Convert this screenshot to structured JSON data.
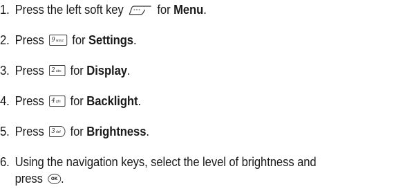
{
  "steps": [
    {
      "num": "1.",
      "pre": "Press the left soft key",
      "post": "for",
      "bold": "Menu",
      "tail": "."
    },
    {
      "num": "2.",
      "pre": "Press",
      "key": {
        "digit": "9",
        "letters": "wxyz"
      },
      "post": "for",
      "bold": "Settings",
      "tail": "."
    },
    {
      "num": "3.",
      "pre": "Press",
      "key": {
        "digit": "2",
        "letters": "abc"
      },
      "post": "for",
      "bold": "Display",
      "tail": "."
    },
    {
      "num": "4.",
      "pre": "Press",
      "key": {
        "digit": "4",
        "letters": "ghi"
      },
      "post": "for",
      "bold": "Backlight",
      "tail": "."
    },
    {
      "num": "5.",
      "pre": "Press",
      "key": {
        "digit": "3",
        "letters": "def"
      },
      "post": "for",
      "bold": "Brightness",
      "tail": "."
    },
    {
      "num": "6.",
      "line1": "Using the navigation keys, select the level of brightness and",
      "line2": "press",
      "ok": "OK",
      "tail": "."
    }
  ],
  "icons": {
    "soft_key": "left-soft-key-icon",
    "ok_key": "ok-key-icon"
  }
}
